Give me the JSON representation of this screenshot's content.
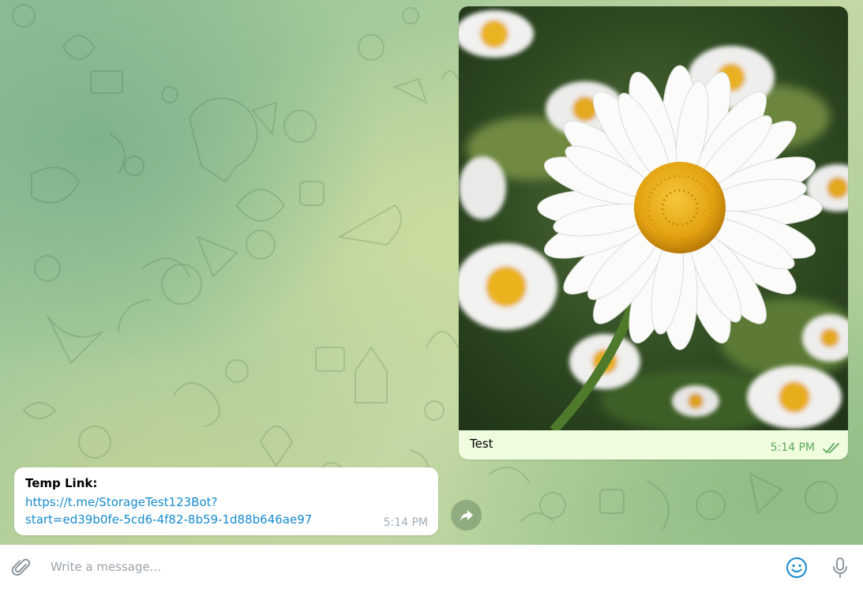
{
  "theme": {
    "outgoing_bubble": "#effdde",
    "incoming_bubble": "#ffffff",
    "link_color": "#168acd",
    "outgoing_time_color": "#5fa75f",
    "icon_color": "#8a969f"
  },
  "messages": [
    {
      "direction": "outgoing",
      "type": "photo",
      "photo": "white-daisy-flower",
      "caption": "Test",
      "time": "5:14 PM",
      "status": "read-double-check-icon"
    },
    {
      "direction": "incoming",
      "type": "text",
      "title": "Temp Link:",
      "url_line1": "https://t.me/StorageTest123Bot?",
      "url_line2": "start=ed39b0fe-5cd6-4f82-8b59-1d88b646ae97",
      "time": "5:14 PM",
      "action": "forward-icon"
    }
  ],
  "composer": {
    "placeholder": "Write a message...",
    "value": "",
    "attach_icon": "paperclip-icon",
    "emoji_icon": "smile-icon",
    "voice_icon": "microphone-icon"
  }
}
